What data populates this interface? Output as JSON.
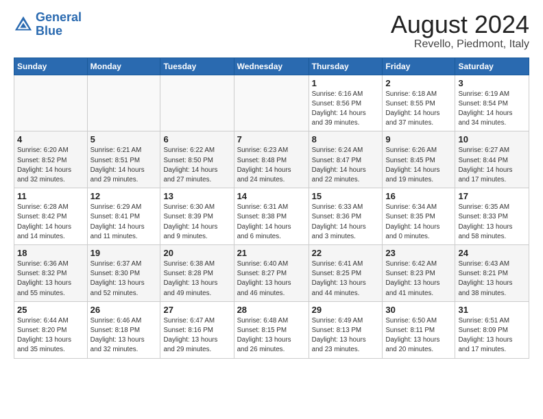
{
  "header": {
    "logo_line1": "General",
    "logo_line2": "Blue",
    "main_title": "August 2024",
    "subtitle": "Revello, Piedmont, Italy"
  },
  "days_of_week": [
    "Sunday",
    "Monday",
    "Tuesday",
    "Wednesday",
    "Thursday",
    "Friday",
    "Saturday"
  ],
  "weeks": [
    {
      "days": [
        {
          "num": "",
          "info": ""
        },
        {
          "num": "",
          "info": ""
        },
        {
          "num": "",
          "info": ""
        },
        {
          "num": "",
          "info": ""
        },
        {
          "num": "1",
          "info": "Sunrise: 6:16 AM\nSunset: 8:56 PM\nDaylight: 14 hours\nand 39 minutes."
        },
        {
          "num": "2",
          "info": "Sunrise: 6:18 AM\nSunset: 8:55 PM\nDaylight: 14 hours\nand 37 minutes."
        },
        {
          "num": "3",
          "info": "Sunrise: 6:19 AM\nSunset: 8:54 PM\nDaylight: 14 hours\nand 34 minutes."
        }
      ]
    },
    {
      "days": [
        {
          "num": "4",
          "info": "Sunrise: 6:20 AM\nSunset: 8:52 PM\nDaylight: 14 hours\nand 32 minutes."
        },
        {
          "num": "5",
          "info": "Sunrise: 6:21 AM\nSunset: 8:51 PM\nDaylight: 14 hours\nand 29 minutes."
        },
        {
          "num": "6",
          "info": "Sunrise: 6:22 AM\nSunset: 8:50 PM\nDaylight: 14 hours\nand 27 minutes."
        },
        {
          "num": "7",
          "info": "Sunrise: 6:23 AM\nSunset: 8:48 PM\nDaylight: 14 hours\nand 24 minutes."
        },
        {
          "num": "8",
          "info": "Sunrise: 6:24 AM\nSunset: 8:47 PM\nDaylight: 14 hours\nand 22 minutes."
        },
        {
          "num": "9",
          "info": "Sunrise: 6:26 AM\nSunset: 8:45 PM\nDaylight: 14 hours\nand 19 minutes."
        },
        {
          "num": "10",
          "info": "Sunrise: 6:27 AM\nSunset: 8:44 PM\nDaylight: 14 hours\nand 17 minutes."
        }
      ]
    },
    {
      "days": [
        {
          "num": "11",
          "info": "Sunrise: 6:28 AM\nSunset: 8:42 PM\nDaylight: 14 hours\nand 14 minutes."
        },
        {
          "num": "12",
          "info": "Sunrise: 6:29 AM\nSunset: 8:41 PM\nDaylight: 14 hours\nand 11 minutes."
        },
        {
          "num": "13",
          "info": "Sunrise: 6:30 AM\nSunset: 8:39 PM\nDaylight: 14 hours\nand 9 minutes."
        },
        {
          "num": "14",
          "info": "Sunrise: 6:31 AM\nSunset: 8:38 PM\nDaylight: 14 hours\nand 6 minutes."
        },
        {
          "num": "15",
          "info": "Sunrise: 6:33 AM\nSunset: 8:36 PM\nDaylight: 14 hours\nand 3 minutes."
        },
        {
          "num": "16",
          "info": "Sunrise: 6:34 AM\nSunset: 8:35 PM\nDaylight: 14 hours\nand 0 minutes."
        },
        {
          "num": "17",
          "info": "Sunrise: 6:35 AM\nSunset: 8:33 PM\nDaylight: 13 hours\nand 58 minutes."
        }
      ]
    },
    {
      "days": [
        {
          "num": "18",
          "info": "Sunrise: 6:36 AM\nSunset: 8:32 PM\nDaylight: 13 hours\nand 55 minutes."
        },
        {
          "num": "19",
          "info": "Sunrise: 6:37 AM\nSunset: 8:30 PM\nDaylight: 13 hours\nand 52 minutes."
        },
        {
          "num": "20",
          "info": "Sunrise: 6:38 AM\nSunset: 8:28 PM\nDaylight: 13 hours\nand 49 minutes."
        },
        {
          "num": "21",
          "info": "Sunrise: 6:40 AM\nSunset: 8:27 PM\nDaylight: 13 hours\nand 46 minutes."
        },
        {
          "num": "22",
          "info": "Sunrise: 6:41 AM\nSunset: 8:25 PM\nDaylight: 13 hours\nand 44 minutes."
        },
        {
          "num": "23",
          "info": "Sunrise: 6:42 AM\nSunset: 8:23 PM\nDaylight: 13 hours\nand 41 minutes."
        },
        {
          "num": "24",
          "info": "Sunrise: 6:43 AM\nSunset: 8:21 PM\nDaylight: 13 hours\nand 38 minutes."
        }
      ]
    },
    {
      "days": [
        {
          "num": "25",
          "info": "Sunrise: 6:44 AM\nSunset: 8:20 PM\nDaylight: 13 hours\nand 35 minutes."
        },
        {
          "num": "26",
          "info": "Sunrise: 6:46 AM\nSunset: 8:18 PM\nDaylight: 13 hours\nand 32 minutes."
        },
        {
          "num": "27",
          "info": "Sunrise: 6:47 AM\nSunset: 8:16 PM\nDaylight: 13 hours\nand 29 minutes."
        },
        {
          "num": "28",
          "info": "Sunrise: 6:48 AM\nSunset: 8:15 PM\nDaylight: 13 hours\nand 26 minutes."
        },
        {
          "num": "29",
          "info": "Sunrise: 6:49 AM\nSunset: 8:13 PM\nDaylight: 13 hours\nand 23 minutes."
        },
        {
          "num": "30",
          "info": "Sunrise: 6:50 AM\nSunset: 8:11 PM\nDaylight: 13 hours\nand 20 minutes."
        },
        {
          "num": "31",
          "info": "Sunrise: 6:51 AM\nSunset: 8:09 PM\nDaylight: 13 hours\nand 17 minutes."
        }
      ]
    }
  ]
}
